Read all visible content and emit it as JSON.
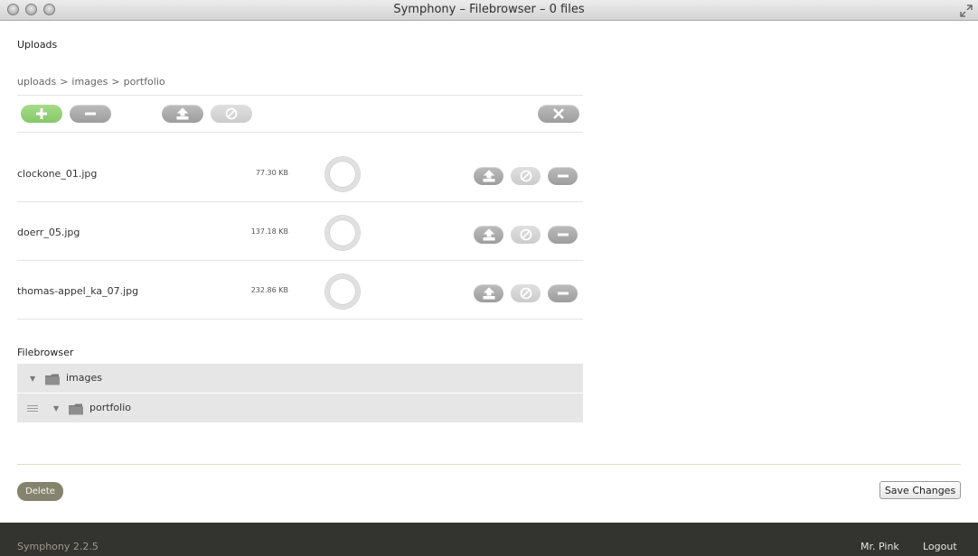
{
  "window": {
    "title": "Symphony – Filebrowser – 0 files"
  },
  "uploads": {
    "heading": "Uploads",
    "breadcrumb": [
      "uploads",
      ">",
      "images",
      ">",
      "portfolio"
    ],
    "toolbar": {
      "add_icon": "plus-icon",
      "remove_icon": "minus-icon",
      "upload_icon": "upload-icon",
      "cancel_icon": "cancel-icon",
      "clear_icon": "close-icon"
    },
    "files": [
      {
        "name": "clockone_01.jpg",
        "size": "77.30 KB"
      },
      {
        "name": "doerr_05.jpg",
        "size": "137.18 KB"
      },
      {
        "name": "thomas-appel_ka_07.jpg",
        "size": "232.86 KB"
      }
    ]
  },
  "filebrowser": {
    "heading": "Filebrowser",
    "tree": [
      {
        "label": "images",
        "expanded": true
      },
      {
        "label": "portfolio",
        "expanded": true
      }
    ]
  },
  "actions": {
    "delete_label": "Delete",
    "save_label": "Save Changes"
  },
  "footer": {
    "version": "Symphony 2.2.5",
    "user": "Mr. Pink",
    "logout": "Logout"
  },
  "colors": {
    "accent_green": "#8fd071",
    "footer_bg": "#333330",
    "delete_bg": "#84846e"
  }
}
